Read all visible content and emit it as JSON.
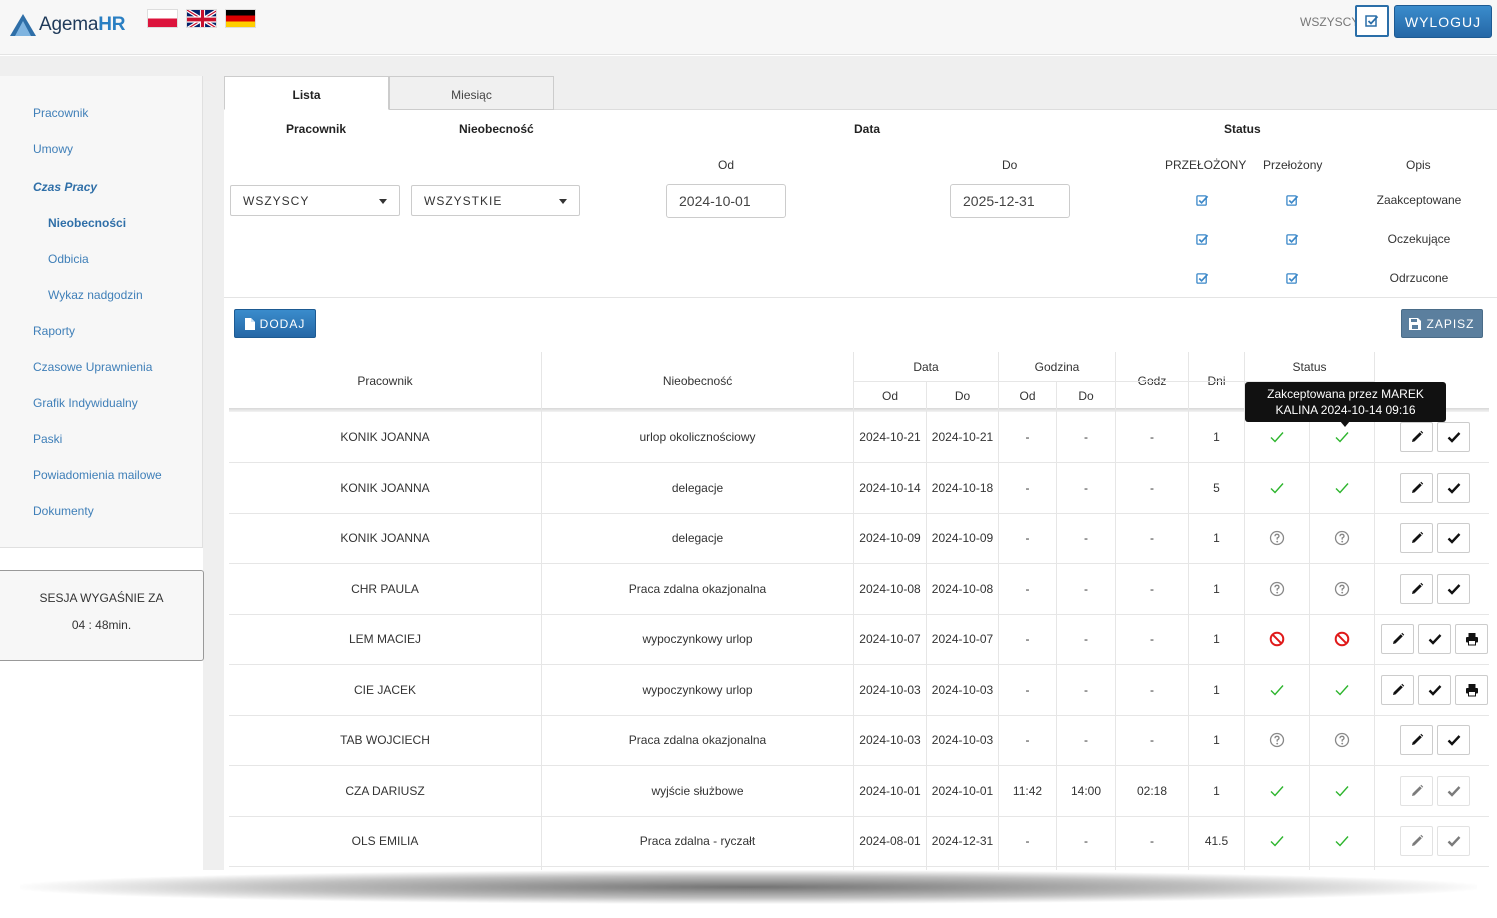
{
  "header": {
    "logo_prefix": "Agema",
    "logo_suffix": "HR",
    "flags": [
      "pl",
      "en",
      "de"
    ],
    "wszyscy_label": "WSZYSCY:",
    "logout_label": "WYLOGUJ",
    "accent_color": "#2a6ea8"
  },
  "sidebar": {
    "items": [
      {
        "label": "Pracownik"
      },
      {
        "label": "Umowy"
      },
      {
        "label": "Czas Pracy"
      },
      {
        "label": "Nieobecności"
      },
      {
        "label": "Odbicia"
      },
      {
        "label": "Wykaz nadgodzin"
      },
      {
        "label": "Raporty"
      },
      {
        "label": "Czasowe Uprawnienia"
      },
      {
        "label": "Grafik Indywidualny"
      },
      {
        "label": "Paski"
      },
      {
        "label": "Powiadomienia mailowe"
      },
      {
        "label": "Dokumenty"
      }
    ],
    "session_title": "SESJA WYGAŚNIE ZA",
    "session_time": "04 : 48min."
  },
  "tabs": [
    {
      "label": "Lista"
    },
    {
      "label": "Miesiąc"
    }
  ],
  "filter": {
    "pracownik_header": "Pracownik",
    "nieobecnosc_header": "Nieobecność",
    "data_header": "Data",
    "status_header": "Status",
    "od_label": "Od",
    "do_label": "Do",
    "pracownik_value": "WSZYSCY",
    "nieobecnosc_value": "WSZYSTKIE",
    "date_from": "2024-10-01",
    "date_to": "2025-12-31",
    "col_przelozony_upper": "PRZEŁOŻONY",
    "col_przelozony": "Przełożony",
    "col_opis": "Opis",
    "statuses": [
      "Zaakceptowane",
      "Oczekujące",
      "Odrzucone"
    ]
  },
  "toolbar": {
    "add_label": "DODAJ",
    "save_label": "ZAPISZ"
  },
  "table": {
    "headers": {
      "pracownik": "Pracownik",
      "nieobecnosc": "Nieobecność",
      "data": "Data",
      "godzina": "Godzina",
      "godz": "Godz",
      "dni": "Dni",
      "status": "Status",
      "od": "Od",
      "do": "Do"
    },
    "rows": [
      {
        "name": "KONIK JOANNA",
        "type": "urlop okolicznościowy",
        "date_from": "2024-10-21",
        "date_to": "2024-10-21",
        "h_from": "-",
        "h_to": "-",
        "hours": "-",
        "days": "1",
        "s1": "ok",
        "s2": "ok",
        "actions": [
          "edit",
          "check"
        ]
      },
      {
        "name": "KONIK JOANNA",
        "type": "delegacje",
        "date_from": "2024-10-14",
        "date_to": "2024-10-18",
        "h_from": "-",
        "h_to": "-",
        "hours": "-",
        "days": "5",
        "s1": "ok",
        "s2": "ok",
        "actions": [
          "edit",
          "check"
        ]
      },
      {
        "name": "KONIK JOANNA",
        "type": "delegacje",
        "date_from": "2024-10-09",
        "date_to": "2024-10-09",
        "h_from": "-",
        "h_to": "-",
        "hours": "-",
        "days": "1",
        "s1": "pending",
        "s2": "pending",
        "actions": [
          "edit",
          "check"
        ]
      },
      {
        "name": "CHR PAULA",
        "type": "Praca zdalna okazjonalna",
        "date_from": "2024-10-08",
        "date_to": "2024-10-08",
        "h_from": "-",
        "h_to": "-",
        "hours": "-",
        "days": "1",
        "s1": "pending",
        "s2": "pending",
        "actions": [
          "edit",
          "check"
        ]
      },
      {
        "name": "LEM MACIEJ",
        "type": "wypoczynkowy urlop",
        "date_from": "2024-10-07",
        "date_to": "2024-10-07",
        "h_from": "-",
        "h_to": "-",
        "hours": "-",
        "days": "1",
        "s1": "rejected",
        "s2": "rejected",
        "actions": [
          "edit",
          "check",
          "print"
        ]
      },
      {
        "name": "CIE JACEK",
        "type": "wypoczynkowy urlop",
        "date_from": "2024-10-03",
        "date_to": "2024-10-03",
        "h_from": "-",
        "h_to": "-",
        "hours": "-",
        "days": "1",
        "s1": "ok",
        "s2": "ok",
        "actions": [
          "edit",
          "check",
          "print"
        ]
      },
      {
        "name": "TAB WOJCIECH",
        "type": "Praca zdalna okazjonalna",
        "date_from": "2024-10-03",
        "date_to": "2024-10-03",
        "h_from": "-",
        "h_to": "-",
        "hours": "-",
        "days": "1",
        "s1": "pending",
        "s2": "pending",
        "actions": [
          "edit",
          "check"
        ]
      },
      {
        "name": "CZA DARIUSZ",
        "type": "wyjście służbowe",
        "date_from": "2024-10-01",
        "date_to": "2024-10-01",
        "h_from": "11:42",
        "h_to": "14:00",
        "hours": "02:18",
        "days": "1",
        "s1": "ok",
        "s2": "ok",
        "actions": [
          "edit",
          "check"
        ],
        "dim": true
      },
      {
        "name": "OLS EMILIA",
        "type": "Praca zdalna - ryczałt",
        "date_from": "2024-08-01",
        "date_to": "2024-12-31",
        "h_from": "-",
        "h_to": "-",
        "hours": "-",
        "days": "41.5",
        "s1": "ok",
        "s2": "ok",
        "actions": [
          "edit",
          "check"
        ],
        "dim": true
      }
    ]
  },
  "tooltip": {
    "line1": "Zakcептowana przez MAREK",
    "line2": "KALINA 2024-10-14 09:16"
  },
  "colors": {
    "ok": "#2db52d",
    "pending": "#888888",
    "rejected": "#e01a1a",
    "link": "#3f7fb8",
    "checkbox": "#3a87c8"
  }
}
